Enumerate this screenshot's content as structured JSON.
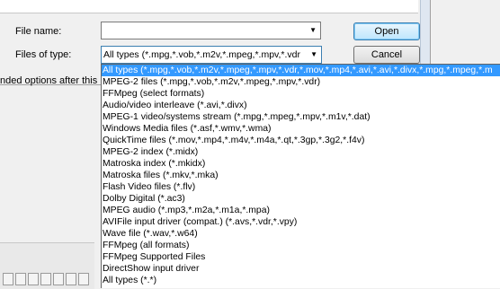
{
  "dialog": {
    "file_name_label": "File name:",
    "file_name_value": "",
    "files_of_type_label": "Files of type:",
    "files_of_type_value": "All types (*.mpg,*.vob,*.m2v,*.mpeg,*.mpv,*.vdr",
    "open_label": "Open",
    "cancel_label": "Cancel",
    "truncated_text": "nded options after this"
  },
  "dropdown": {
    "options": [
      "All types (*.mpg,*.vob,*.m2v,*.mpeg,*.mpv,*.vdr,*.mov,*.mp4,*.avi,*.avi,*.divx,*.mpg,*.mpeg,*.m",
      "MPEG-2 files (*.mpg,*.vob,*.m2v,*.mpeg,*.mpv,*.vdr)",
      "FFMpeg (select formats)",
      "Audio/video interleave (*.avi,*.divx)",
      "MPEG-1 video/systems stream (*.mpg,*.mpeg,*.mpv,*.m1v,*.dat)",
      "Windows Media files (*.asf,*.wmv,*.wma)",
      "QuickTime files (*.mov,*.mp4,*.m4v,*.m4a,*.qt,*.3gp,*.3g2,*.f4v)",
      "MPEG-2 index (*.midx)",
      "Matroska index (*.mkidx)",
      "Matroska files (*.mkv,*.mka)",
      "Flash Video files (*.flv)",
      "Dolby Digital (*.ac3)",
      "MPEG audio (*.mp3,*.m2a,*.m1a,*.mpa)",
      "AVIFile input driver (compat.) (*.avs,*.vdr,*.vpy)",
      "Wave file (*.wav,*.w64)",
      "FFMpeg (all formats)",
      "FFMpeg Supported Files",
      "DirectShow input driver",
      "All types (*.*)"
    ],
    "selected_index": 0
  },
  "colors": {
    "selection": "#3399ff",
    "accent_border": "#3c7fb1"
  },
  "icons": {
    "combo_arrow": "chevron-down-icon"
  }
}
